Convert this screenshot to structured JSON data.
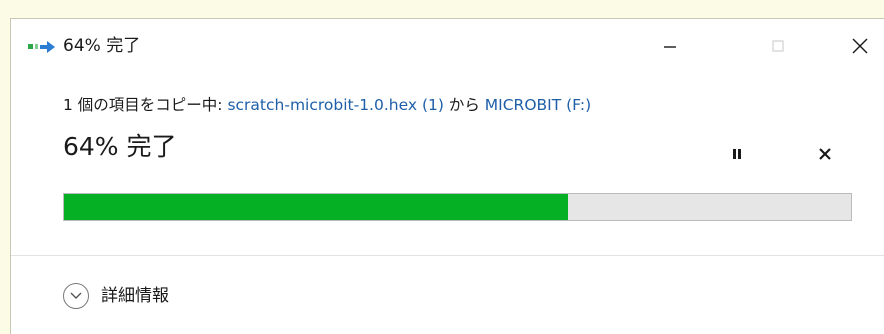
{
  "window": {
    "title": "64% 完了",
    "icon": "copy-transfer-icon",
    "controls": {
      "minimize_icon": "minimize-icon",
      "maximize_icon": "maximize-icon",
      "close_icon": "close-icon"
    }
  },
  "copy": {
    "prefix": "1 個の項目をコピー中: ",
    "source": "scratch-microbit-1.0.hex (1)",
    "connector": " から ",
    "destination": "MICROBIT (F:)",
    "status": "64% 完了",
    "progress": 0.64,
    "pause_icon": "pause-icon",
    "cancel_icon": "cancel-icon"
  },
  "details": {
    "label": "詳細情報",
    "icon": "chevron-down-circle-icon"
  },
  "colors": {
    "progress_fill": "#06b025",
    "progress_track": "#e6e6e6",
    "link": "#1f5fa8",
    "background": "#fbfbe6"
  }
}
